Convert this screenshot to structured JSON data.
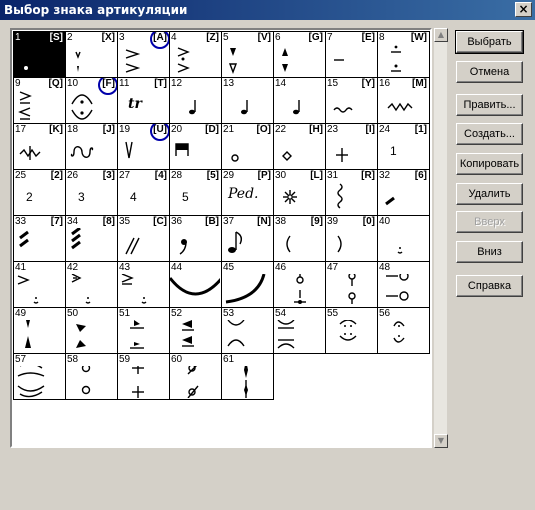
{
  "window": {
    "title": "Выбор знака артикуляции",
    "close": "×"
  },
  "buttons": {
    "select": "Выбрать",
    "cancel": "Отмена",
    "edit": "Править...",
    "create": "Создать...",
    "copy": "Копировать",
    "delete": "Удалить",
    "up": "Вверх",
    "down": "Вниз",
    "help": "Справка"
  },
  "scrollbar": {
    "up_arrow": "▲",
    "down_arrow": "▼"
  },
  "cells": [
    {
      "n": "1",
      "key": "[S]",
      "sym": "staccato",
      "selected": true
    },
    {
      "n": "2",
      "key": "[X]",
      "sym": "staccatissimo"
    },
    {
      "n": "3",
      "key": "[A]",
      "sym": "accent",
      "circled": true
    },
    {
      "n": "4",
      "key": "[Z]",
      "sym": "accent-staccato"
    },
    {
      "n": "5",
      "key": "[V]",
      "sym": "wedge-pair"
    },
    {
      "n": "6",
      "key": "[G]",
      "sym": "wedge-pair-2"
    },
    {
      "n": "7",
      "key": "[E]",
      "sym": "tenuto"
    },
    {
      "n": "8",
      "key": "[W]",
      "sym": "tenuto-staccato"
    },
    {
      "n": "9",
      "key": "[Q]",
      "sym": "accent-tenuto"
    },
    {
      "n": "10",
      "key": "[F]",
      "sym": "fermata",
      "circled": true
    },
    {
      "n": "11",
      "key": "[T]",
      "sym": "trill"
    },
    {
      "n": "12",
      "key": "",
      "sym": "grace"
    },
    {
      "n": "13",
      "key": "",
      "sym": "grace"
    },
    {
      "n": "14",
      "key": "",
      "sym": "grace"
    },
    {
      "n": "15",
      "key": "[Y]",
      "sym": "trill-wave"
    },
    {
      "n": "16",
      "key": "[M]",
      "sym": "mordent"
    },
    {
      "n": "17",
      "key": "[K]",
      "sym": "inverted-mordent"
    },
    {
      "n": "18",
      "key": "[J]",
      "sym": "turn"
    },
    {
      "n": "19",
      "key": "[U]",
      "sym": "upbow",
      "circled": true
    },
    {
      "n": "20",
      "key": "[D]",
      "sym": "downbow"
    },
    {
      "n": "21",
      "key": "[O]",
      "sym": "harmonic"
    },
    {
      "n": "22",
      "key": "[H]",
      "sym": "diamond"
    },
    {
      "n": "23",
      "key": "[I]",
      "sym": "plus"
    },
    {
      "n": "24",
      "key": "[1]",
      "sym": "finger",
      "text": "1"
    },
    {
      "n": "25",
      "key": "[2]",
      "sym": "finger",
      "text": "2"
    },
    {
      "n": "26",
      "key": "[3]",
      "sym": "finger",
      "text": "3"
    },
    {
      "n": "27",
      "key": "[4]",
      "sym": "finger",
      "text": "4"
    },
    {
      "n": "28",
      "key": "[5]",
      "sym": "finger",
      "text": "5"
    },
    {
      "n": "29",
      "key": "[P]",
      "sym": "ped",
      "text": "Ped."
    },
    {
      "n": "30",
      "key": "[L]",
      "sym": "ped-release"
    },
    {
      "n": "31",
      "key": "[R]",
      "sym": "arpeggio"
    },
    {
      "n": "32",
      "key": "[6]",
      "sym": "tremolo-1"
    },
    {
      "n": "33",
      "key": "[7]",
      "sym": "tremolo-2"
    },
    {
      "n": "34",
      "key": "[8]",
      "sym": "tremolo-3"
    },
    {
      "n": "35",
      "key": "[C]",
      "sym": "slashes"
    },
    {
      "n": "36",
      "key": "[B]",
      "sym": "breath"
    },
    {
      "n": "37",
      "key": "[N]",
      "sym": "note"
    },
    {
      "n": "38",
      "key": "[9]",
      "sym": "paren-left"
    },
    {
      "n": "39",
      "key": "[0]",
      "sym": "paren-right"
    },
    {
      "n": "40",
      "key": "",
      "sym": "small-dot"
    },
    {
      "n": "41",
      "key": "",
      "sym": "accent-small"
    },
    {
      "n": "42",
      "key": "",
      "sym": "accent-open"
    },
    {
      "n": "43",
      "key": "",
      "sym": "accent-bar"
    },
    {
      "n": "44",
      "key": "",
      "sym": "slur-big"
    },
    {
      "n": "45",
      "key": "",
      "sym": "slur-curve"
    },
    {
      "n": "46",
      "key": "",
      "sym": "stem-note"
    },
    {
      "n": "47",
      "key": "",
      "sym": "stem-note-2"
    },
    {
      "n": "48",
      "key": "",
      "sym": "circle-line"
    },
    {
      "n": "49",
      "key": "",
      "sym": "wedge-up-down"
    },
    {
      "n": "50",
      "key": "",
      "sym": "wedge-tilt"
    },
    {
      "n": "51",
      "key": "",
      "sym": "wedge-bar"
    },
    {
      "n": "52",
      "key": "",
      "sym": "wedge-solid"
    },
    {
      "n": "53",
      "key": "",
      "sym": "arc-pair"
    },
    {
      "n": "54",
      "key": "",
      "sym": "arc-line"
    },
    {
      "n": "55",
      "key": "",
      "sym": "face"
    },
    {
      "n": "56",
      "key": "",
      "sym": "face-2"
    },
    {
      "n": "57",
      "key": "",
      "sym": "lens"
    },
    {
      "n": "58",
      "key": "",
      "sym": "circles"
    },
    {
      "n": "59",
      "key": "",
      "sym": "pluses"
    },
    {
      "n": "60",
      "key": "",
      "sym": "ghost"
    },
    {
      "n": "61",
      "key": "",
      "sym": "dagger"
    }
  ]
}
